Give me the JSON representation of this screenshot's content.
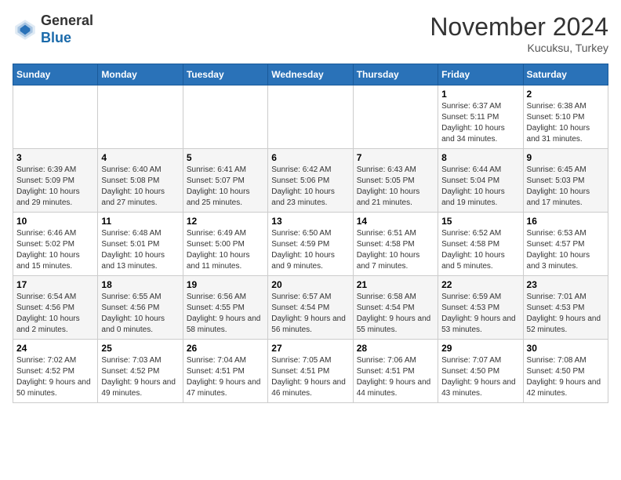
{
  "logo": {
    "general": "General",
    "blue": "Blue"
  },
  "header": {
    "month": "November 2024",
    "location": "Kucuksu, Turkey"
  },
  "days_of_week": [
    "Sunday",
    "Monday",
    "Tuesday",
    "Wednesday",
    "Thursday",
    "Friday",
    "Saturday"
  ],
  "weeks": [
    [
      {
        "day": "",
        "sunrise": "",
        "sunset": "",
        "daylight": ""
      },
      {
        "day": "",
        "sunrise": "",
        "sunset": "",
        "daylight": ""
      },
      {
        "day": "",
        "sunrise": "",
        "sunset": "",
        "daylight": ""
      },
      {
        "day": "",
        "sunrise": "",
        "sunset": "",
        "daylight": ""
      },
      {
        "day": "",
        "sunrise": "",
        "sunset": "",
        "daylight": ""
      },
      {
        "day": "1",
        "sunrise": "Sunrise: 6:37 AM",
        "sunset": "Sunset: 5:11 PM",
        "daylight": "Daylight: 10 hours and 34 minutes."
      },
      {
        "day": "2",
        "sunrise": "Sunrise: 6:38 AM",
        "sunset": "Sunset: 5:10 PM",
        "daylight": "Daylight: 10 hours and 31 minutes."
      }
    ],
    [
      {
        "day": "3",
        "sunrise": "Sunrise: 6:39 AM",
        "sunset": "Sunset: 5:09 PM",
        "daylight": "Daylight: 10 hours and 29 minutes."
      },
      {
        "day": "4",
        "sunrise": "Sunrise: 6:40 AM",
        "sunset": "Sunset: 5:08 PM",
        "daylight": "Daylight: 10 hours and 27 minutes."
      },
      {
        "day": "5",
        "sunrise": "Sunrise: 6:41 AM",
        "sunset": "Sunset: 5:07 PM",
        "daylight": "Daylight: 10 hours and 25 minutes."
      },
      {
        "day": "6",
        "sunrise": "Sunrise: 6:42 AM",
        "sunset": "Sunset: 5:06 PM",
        "daylight": "Daylight: 10 hours and 23 minutes."
      },
      {
        "day": "7",
        "sunrise": "Sunrise: 6:43 AM",
        "sunset": "Sunset: 5:05 PM",
        "daylight": "Daylight: 10 hours and 21 minutes."
      },
      {
        "day": "8",
        "sunrise": "Sunrise: 6:44 AM",
        "sunset": "Sunset: 5:04 PM",
        "daylight": "Daylight: 10 hours and 19 minutes."
      },
      {
        "day": "9",
        "sunrise": "Sunrise: 6:45 AM",
        "sunset": "Sunset: 5:03 PM",
        "daylight": "Daylight: 10 hours and 17 minutes."
      }
    ],
    [
      {
        "day": "10",
        "sunrise": "Sunrise: 6:46 AM",
        "sunset": "Sunset: 5:02 PM",
        "daylight": "Daylight: 10 hours and 15 minutes."
      },
      {
        "day": "11",
        "sunrise": "Sunrise: 6:48 AM",
        "sunset": "Sunset: 5:01 PM",
        "daylight": "Daylight: 10 hours and 13 minutes."
      },
      {
        "day": "12",
        "sunrise": "Sunrise: 6:49 AM",
        "sunset": "Sunset: 5:00 PM",
        "daylight": "Daylight: 10 hours and 11 minutes."
      },
      {
        "day": "13",
        "sunrise": "Sunrise: 6:50 AM",
        "sunset": "Sunset: 4:59 PM",
        "daylight": "Daylight: 10 hours and 9 minutes."
      },
      {
        "day": "14",
        "sunrise": "Sunrise: 6:51 AM",
        "sunset": "Sunset: 4:58 PM",
        "daylight": "Daylight: 10 hours and 7 minutes."
      },
      {
        "day": "15",
        "sunrise": "Sunrise: 6:52 AM",
        "sunset": "Sunset: 4:58 PM",
        "daylight": "Daylight: 10 hours and 5 minutes."
      },
      {
        "day": "16",
        "sunrise": "Sunrise: 6:53 AM",
        "sunset": "Sunset: 4:57 PM",
        "daylight": "Daylight: 10 hours and 3 minutes."
      }
    ],
    [
      {
        "day": "17",
        "sunrise": "Sunrise: 6:54 AM",
        "sunset": "Sunset: 4:56 PM",
        "daylight": "Daylight: 10 hours and 2 minutes."
      },
      {
        "day": "18",
        "sunrise": "Sunrise: 6:55 AM",
        "sunset": "Sunset: 4:56 PM",
        "daylight": "Daylight: 10 hours and 0 minutes."
      },
      {
        "day": "19",
        "sunrise": "Sunrise: 6:56 AM",
        "sunset": "Sunset: 4:55 PM",
        "daylight": "Daylight: 9 hours and 58 minutes."
      },
      {
        "day": "20",
        "sunrise": "Sunrise: 6:57 AM",
        "sunset": "Sunset: 4:54 PM",
        "daylight": "Daylight: 9 hours and 56 minutes."
      },
      {
        "day": "21",
        "sunrise": "Sunrise: 6:58 AM",
        "sunset": "Sunset: 4:54 PM",
        "daylight": "Daylight: 9 hours and 55 minutes."
      },
      {
        "day": "22",
        "sunrise": "Sunrise: 6:59 AM",
        "sunset": "Sunset: 4:53 PM",
        "daylight": "Daylight: 9 hours and 53 minutes."
      },
      {
        "day": "23",
        "sunrise": "Sunrise: 7:01 AM",
        "sunset": "Sunset: 4:53 PM",
        "daylight": "Daylight: 9 hours and 52 minutes."
      }
    ],
    [
      {
        "day": "24",
        "sunrise": "Sunrise: 7:02 AM",
        "sunset": "Sunset: 4:52 PM",
        "daylight": "Daylight: 9 hours and 50 minutes."
      },
      {
        "day": "25",
        "sunrise": "Sunrise: 7:03 AM",
        "sunset": "Sunset: 4:52 PM",
        "daylight": "Daylight: 9 hours and 49 minutes."
      },
      {
        "day": "26",
        "sunrise": "Sunrise: 7:04 AM",
        "sunset": "Sunset: 4:51 PM",
        "daylight": "Daylight: 9 hours and 47 minutes."
      },
      {
        "day": "27",
        "sunrise": "Sunrise: 7:05 AM",
        "sunset": "Sunset: 4:51 PM",
        "daylight": "Daylight: 9 hours and 46 minutes."
      },
      {
        "day": "28",
        "sunrise": "Sunrise: 7:06 AM",
        "sunset": "Sunset: 4:51 PM",
        "daylight": "Daylight: 9 hours and 44 minutes."
      },
      {
        "day": "29",
        "sunrise": "Sunrise: 7:07 AM",
        "sunset": "Sunset: 4:50 PM",
        "daylight": "Daylight: 9 hours and 43 minutes."
      },
      {
        "day": "30",
        "sunrise": "Sunrise: 7:08 AM",
        "sunset": "Sunset: 4:50 PM",
        "daylight": "Daylight: 9 hours and 42 minutes."
      }
    ]
  ]
}
